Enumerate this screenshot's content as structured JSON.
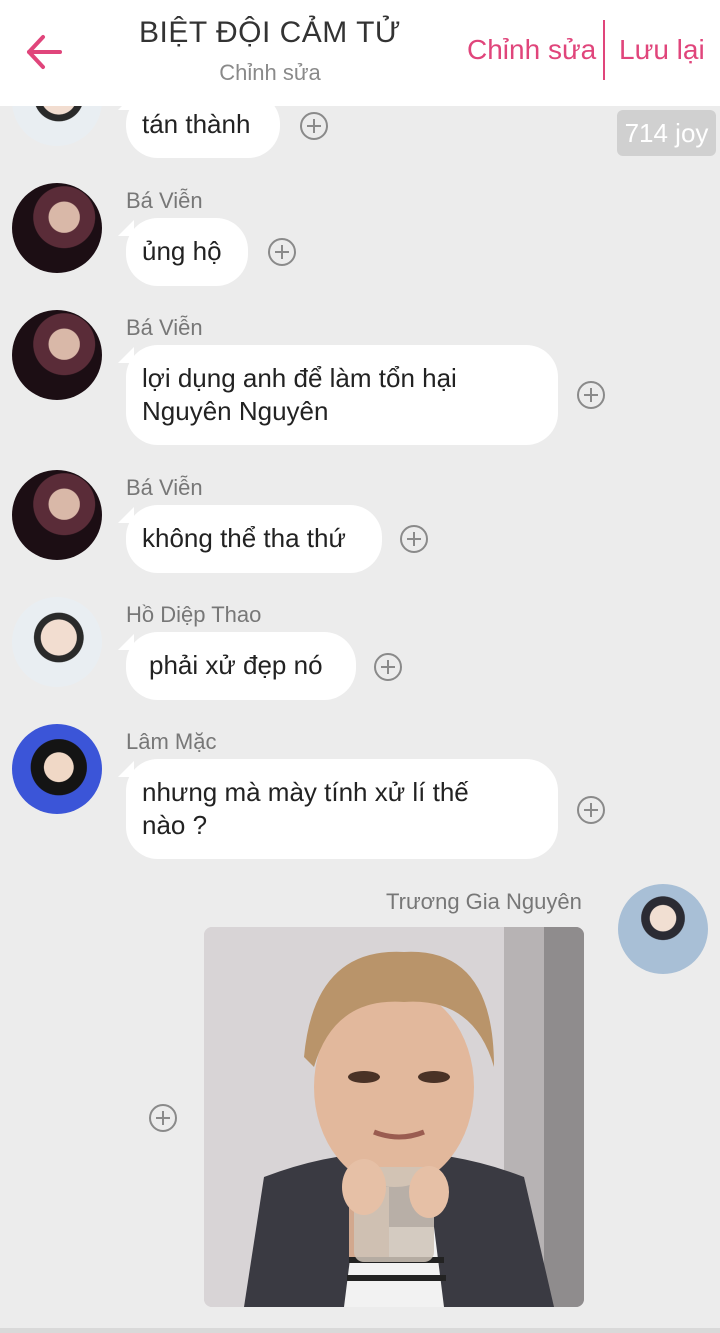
{
  "header": {
    "title": "BIỆT ĐỘI CẢM TỬ",
    "subtitle": "Chỉnh sửa",
    "edit_label": "Chỉnh sửa",
    "save_label": "Lưu lại",
    "accent_color": "#e0457b"
  },
  "joy_badge": "714 joy",
  "messages": [
    {
      "sender": "",
      "text": "tán thành"
    },
    {
      "sender": "Bá Viễn",
      "text": "ủng hộ"
    },
    {
      "sender": "Bá Viễn",
      "line1": "lợi dụng anh để làm tổn hại",
      "line2": "Nguyên Nguyên"
    },
    {
      "sender": "Bá Viễn",
      "text": "không thể tha thứ"
    },
    {
      "sender": "Hồ Diệp Thao",
      "text": "phải xử đẹp nó"
    },
    {
      "sender": "Lâm Mặc",
      "line1": "nhưng mà mày tính xử lí thế",
      "line2": "nào ?"
    },
    {
      "sender": "Trương Gia Nguyên",
      "type": "image"
    }
  ],
  "icons": {
    "back": "arrow-left-icon",
    "add": "plus-circle-icon"
  }
}
